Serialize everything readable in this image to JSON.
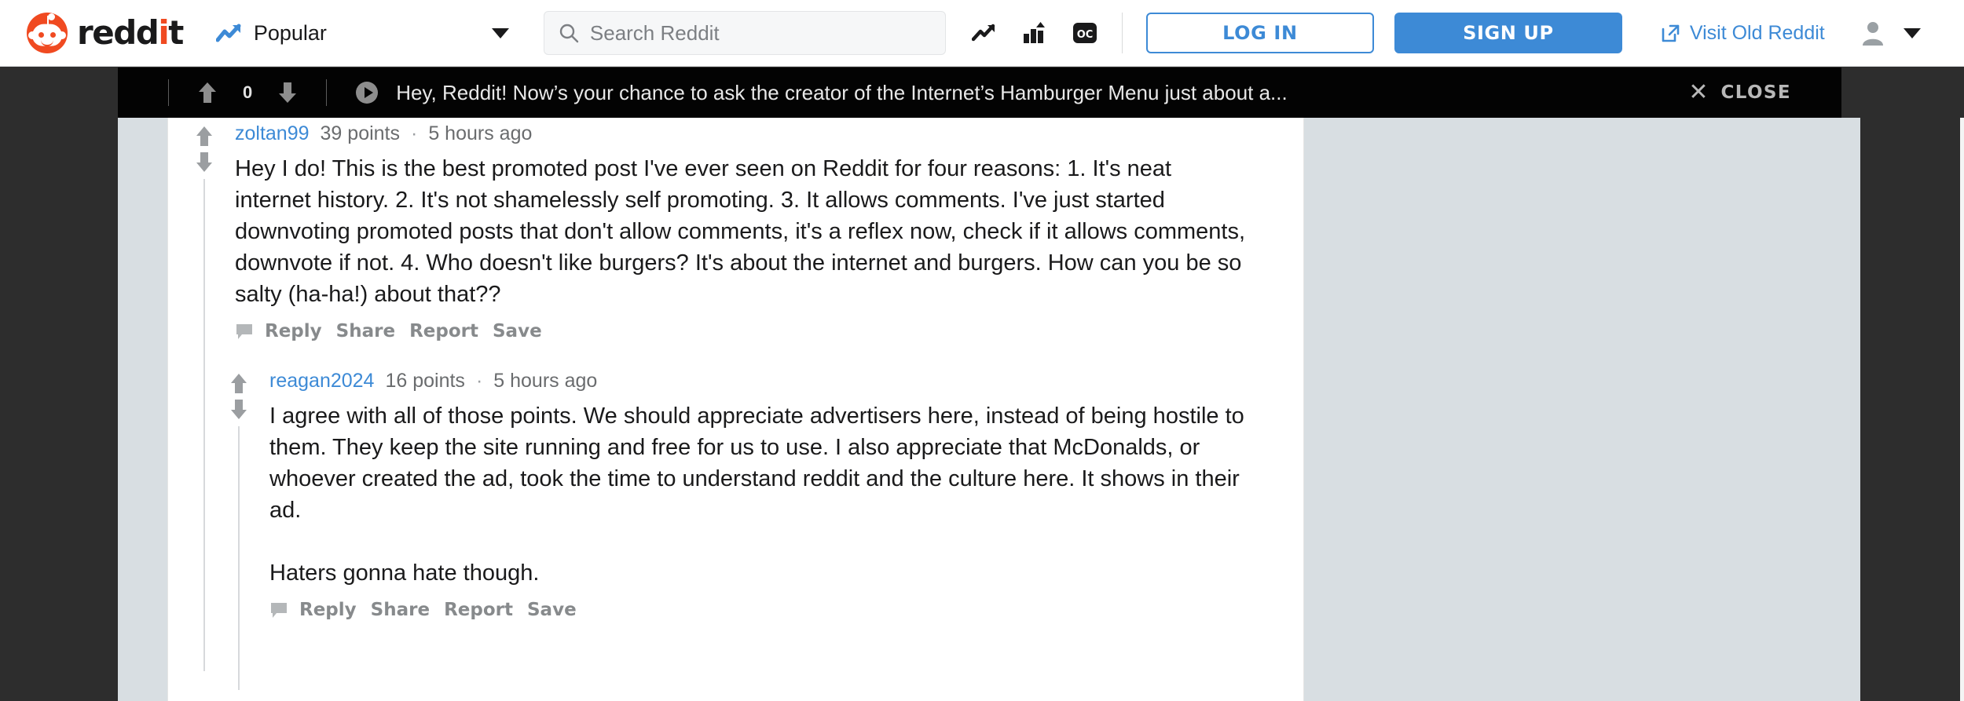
{
  "header": {
    "logo_text_a": "redd",
    "logo_text_b": "i",
    "logo_text_c": "t",
    "logo_icon": "reddit-snoo-icon",
    "feed": {
      "icon": "trending-up-icon",
      "label": "Popular",
      "caret": "chevron-down-icon"
    },
    "search": {
      "icon": "search-icon",
      "placeholder": "Search Reddit",
      "value": ""
    },
    "icons": [
      {
        "name": "trending-posts-icon",
        "glyph": "trending"
      },
      {
        "name": "top-charts-icon",
        "glyph": "bars"
      },
      {
        "name": "original-content-icon",
        "glyph": "oc"
      }
    ],
    "login_label": "LOG IN",
    "signup_label": "SIGN UP",
    "old_reddit": {
      "icon": "external-link-icon",
      "label": "Visit Old Reddit"
    },
    "avatar_icon": "user-avatar-icon",
    "avatar_caret": "chevron-down-icon"
  },
  "promo_bar": {
    "upvote_icon": "upvote-arrow-icon",
    "score": "0",
    "downvote_icon": "downvote-arrow-icon",
    "play_icon": "play-circle-icon",
    "title": "Hey, Reddit! Now’s your chance to ask the creator of the Internet’s Hamburger Menu just about a...",
    "close_icon": "close-x-icon",
    "close_label": "CLOSE"
  },
  "comments": [
    {
      "id": "comment-zoltan99",
      "depth": 0,
      "author": "zoltan99",
      "points": "39 points",
      "separator": "·",
      "time": "5 hours ago",
      "paragraphs": [
        "Hey I do! This is the best promoted post I've ever seen on Reddit for four reasons: 1. It's neat internet history. 2. It's not shamelessly self promoting. 3. It allows comments. I've just started downvoting promoted posts that don't allow comments, it's a reflex now, check if it allows comments, downvote if not. 4. Who doesn't like burgers? It's about the internet and burgers. How can you be so salty (ha-ha!) about that??"
      ],
      "actions": [
        "Reply",
        "Share",
        "Report",
        "Save"
      ],
      "action_icon": "comment-bubble-icon"
    },
    {
      "id": "comment-reagan2024",
      "depth": 1,
      "author": "reagan2024",
      "points": "16 points",
      "separator": "·",
      "time": "5 hours ago",
      "paragraphs": [
        "I agree with all of those points. We should appreciate advertisers here, instead of being hostile to them. They keep the site running and free for us to use. I also appreciate that McDonalds, or whoever created the ad, took the time to understand reddit and the culture here. It shows in their ad.",
        "Haters gonna hate though."
      ],
      "actions": [
        "Reply",
        "Share",
        "Report",
        "Save"
      ],
      "action_icon": "comment-bubble-icon"
    }
  ],
  "colors": {
    "reddit_orange": "#f04a21",
    "link_blue": "#3d8ad6",
    "promo_black": "#030303",
    "page_dark": "#2d2d2d",
    "panel_gray": "#d8dee2",
    "muted_text": "#878a8c"
  }
}
